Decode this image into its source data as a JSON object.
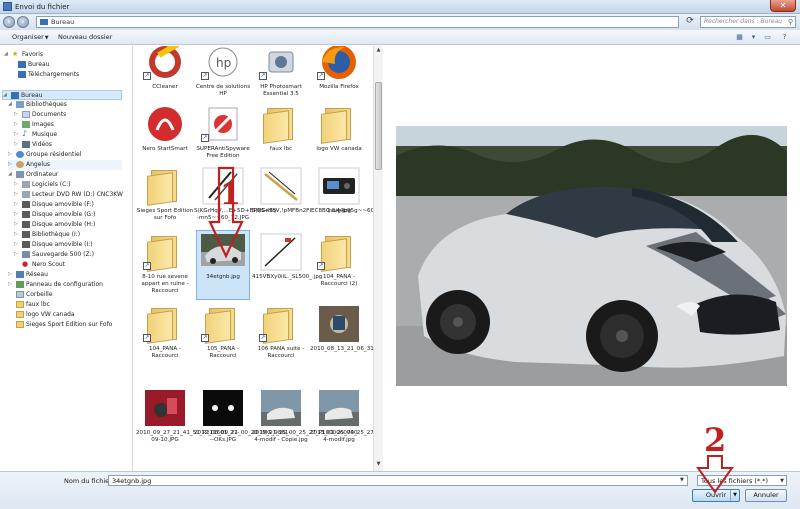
{
  "window": {
    "title": "Envoi du fichier"
  },
  "address": {
    "path": "Bureau",
    "search_placeholder": "Rechercher dans : Bureau"
  },
  "toolbar": {
    "organize": "Organiser",
    "new_folder": "Nouveau dossier"
  },
  "nav": {
    "items": [
      "Favoris",
      "Bureau",
      "Téléchargements",
      "Bureau",
      "Bibliothèques",
      "Documents",
      "Images",
      "Musique",
      "Vidéos",
      "Groupe résidentiel",
      "Angelus",
      "Ordinateur",
      "Logiciels (C:)",
      "Lecteur DVD RW (D:) CNC3KW",
      "Disque amovible (F:)",
      "Disque amovible (G:)",
      "Disque amovible (H:)",
      "Bibliothèque (I:)",
      "Disque amovible (I:)",
      "Sauvegarde 500 (Z:)",
      "Nero Scout",
      "Réseau",
      "Panneau de configuration",
      "Corbeille",
      "faux lbc",
      "logo VW canada",
      "Sieges Sport Edition sur Fofo"
    ]
  },
  "files": [
    "CCleaner",
    "Centre de solutions HP",
    "HP Photosmart Essential 3.5",
    "Mozilla Firefox",
    "Nero StartSmart",
    "SUPERAntiSpyware Free Edition",
    "faux lbc",
    "logo VW canada",
    "Sieges Sport Edition sur Fofo",
    "S(KGrHqV,...E+5D+BPQ5+E5--mn5~~60_12.JPG",
    "S(KGrHqV,!pMFBn2FIEC8BQsL44b95g~~60_12.JPG",
    "1.big.jpg",
    "8-10 rue sevene appart en ruine - Raccourci",
    "34etgnb.jpg",
    "415VBXy0iiL._SL500_.jpg",
    "104_PANA - Raccourci (2)",
    "104_PANA - Raccourci",
    "105_PANA - Raccourci",
    "106 PANA suite - Raccourci",
    "2010_08_13_21_06_31_pommeaux3.JPG",
    "2010_09_27_21_41_51_P211601_27-09-10.JPG",
    "2012_06_09_21_00_20_IMG_9861---OKs.JPG",
    "2013_01_25_00_25_27_P1000060740 4-modif - Copie.jpg",
    "2013_01_25_00_25_27_P1000060740 4-modif.jpg"
  ],
  "bottom": {
    "filename_label": "Nom du fichier :",
    "filename_value": "34etgnb.jpg",
    "filter": "Tous les fichiers (*.*)",
    "open": "Ouvrir",
    "cancel": "Annuler"
  },
  "annotations": {
    "one": "1",
    "two": "2"
  }
}
